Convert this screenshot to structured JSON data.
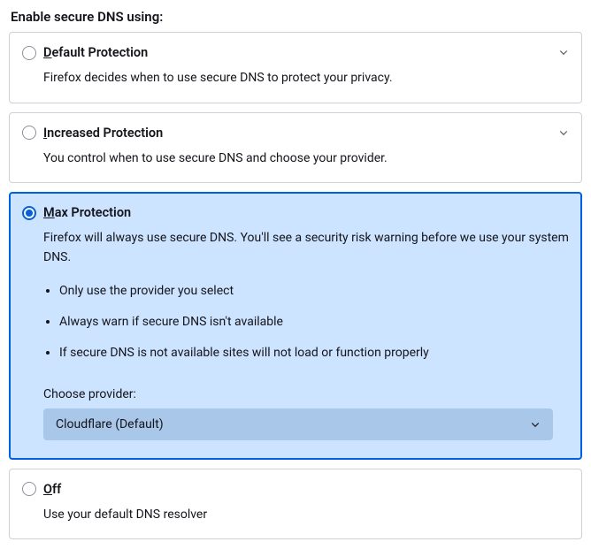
{
  "heading": "Enable secure DNS using:",
  "options": {
    "default": {
      "title_prefix": "D",
      "title_rest": "efault Protection",
      "desc": "Firefox decides when to use secure DNS to protect your privacy."
    },
    "increased": {
      "title_prefix": "I",
      "title_rest": "ncreased Protection",
      "desc": "You control when to use secure DNS and choose your provider."
    },
    "max": {
      "title_prefix": "M",
      "title_rest": "ax Protection",
      "desc": "Firefox will always use secure DNS. You'll see a security risk warning before we use your system DNS.",
      "bullets": [
        "Only use the provider you select",
        "Always warn if secure DNS isn't available",
        "If secure DNS is not available sites will not load or function properly"
      ],
      "provider_label": "Choose provider:",
      "provider_selected": "Cloudflare (Default)"
    },
    "off": {
      "title_prefix": "O",
      "title_rest": "ff",
      "desc": "Use your default DNS resolver"
    }
  }
}
